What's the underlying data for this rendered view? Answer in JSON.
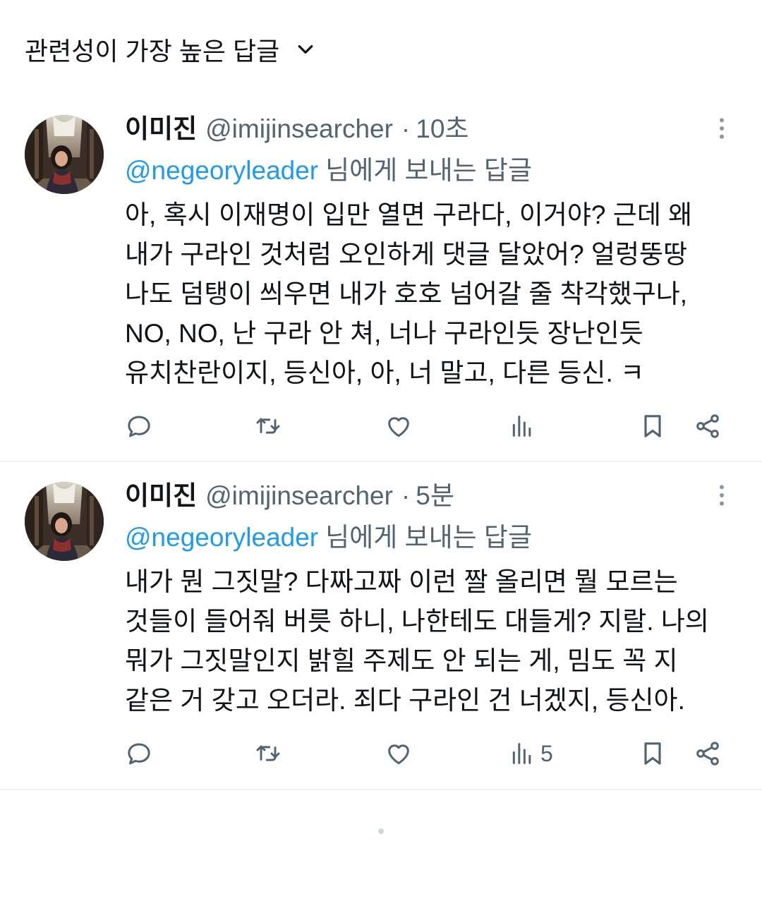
{
  "header": {
    "title": "관련성이 가장 높은 답글",
    "icon": "chevron-down-icon"
  },
  "tweets": [
    {
      "name": "이미진",
      "handle": "@imijinsearcher",
      "separator": "·",
      "time": "10초",
      "reply_to": {
        "handle": "@negeoryleader",
        "suffix": "님에게 보내는 답글"
      },
      "body_lines": [
        "아, 혹시 이재명이 입만 열면 구라다, 이거야? 근데 왜",
        "내가 구라인 것처럼 오인하게 댓글 달았어? 얼렁뚱땅",
        "나도 덤탱이 씌우면 내가 호호 넘어갈 줄 착각했구나,",
        "NO, NO, 난 구라 안 쳐, 너나 구라인듯 장난인듯",
        "유치찬란이지, 등신아, 아, 너 말고, 다른 등신. ㅋ"
      ]
    },
    {
      "name": "이미진",
      "handle": "@imijinsearcher",
      "separator": "·",
      "time": "5분",
      "reply_to": {
        "handle": "@negeoryleader",
        "suffix": "님에게 보내는 답글"
      },
      "body_lines": [
        "내가 뭔 그짓말? 다짜고짜 이런 짤 올리면 뭘 모르는",
        "것들이 들어줘 버릇 하니, 나한테도 대들게? 지랄. 나의",
        "뭐가 그짓말인지 밝힐 주제도 안 되는 게, 밈도 꼭 지",
        "같은 거 갖고 오더라. 죄다 구라인 건 너겠지, 등신아."
      ],
      "views_count": "5"
    }
  ],
  "icons": {
    "more": "more-vertical-icon",
    "reply": "reply-icon",
    "retweet": "retweet-icon",
    "like": "heart-icon",
    "views": "analytics-icon",
    "bookmark": "bookmark-icon",
    "share": "share-icon"
  },
  "colors": {
    "text": "#0f1419",
    "secondary": "#536471",
    "link": "#1d9bf0",
    "divider": "#eff3f4"
  }
}
